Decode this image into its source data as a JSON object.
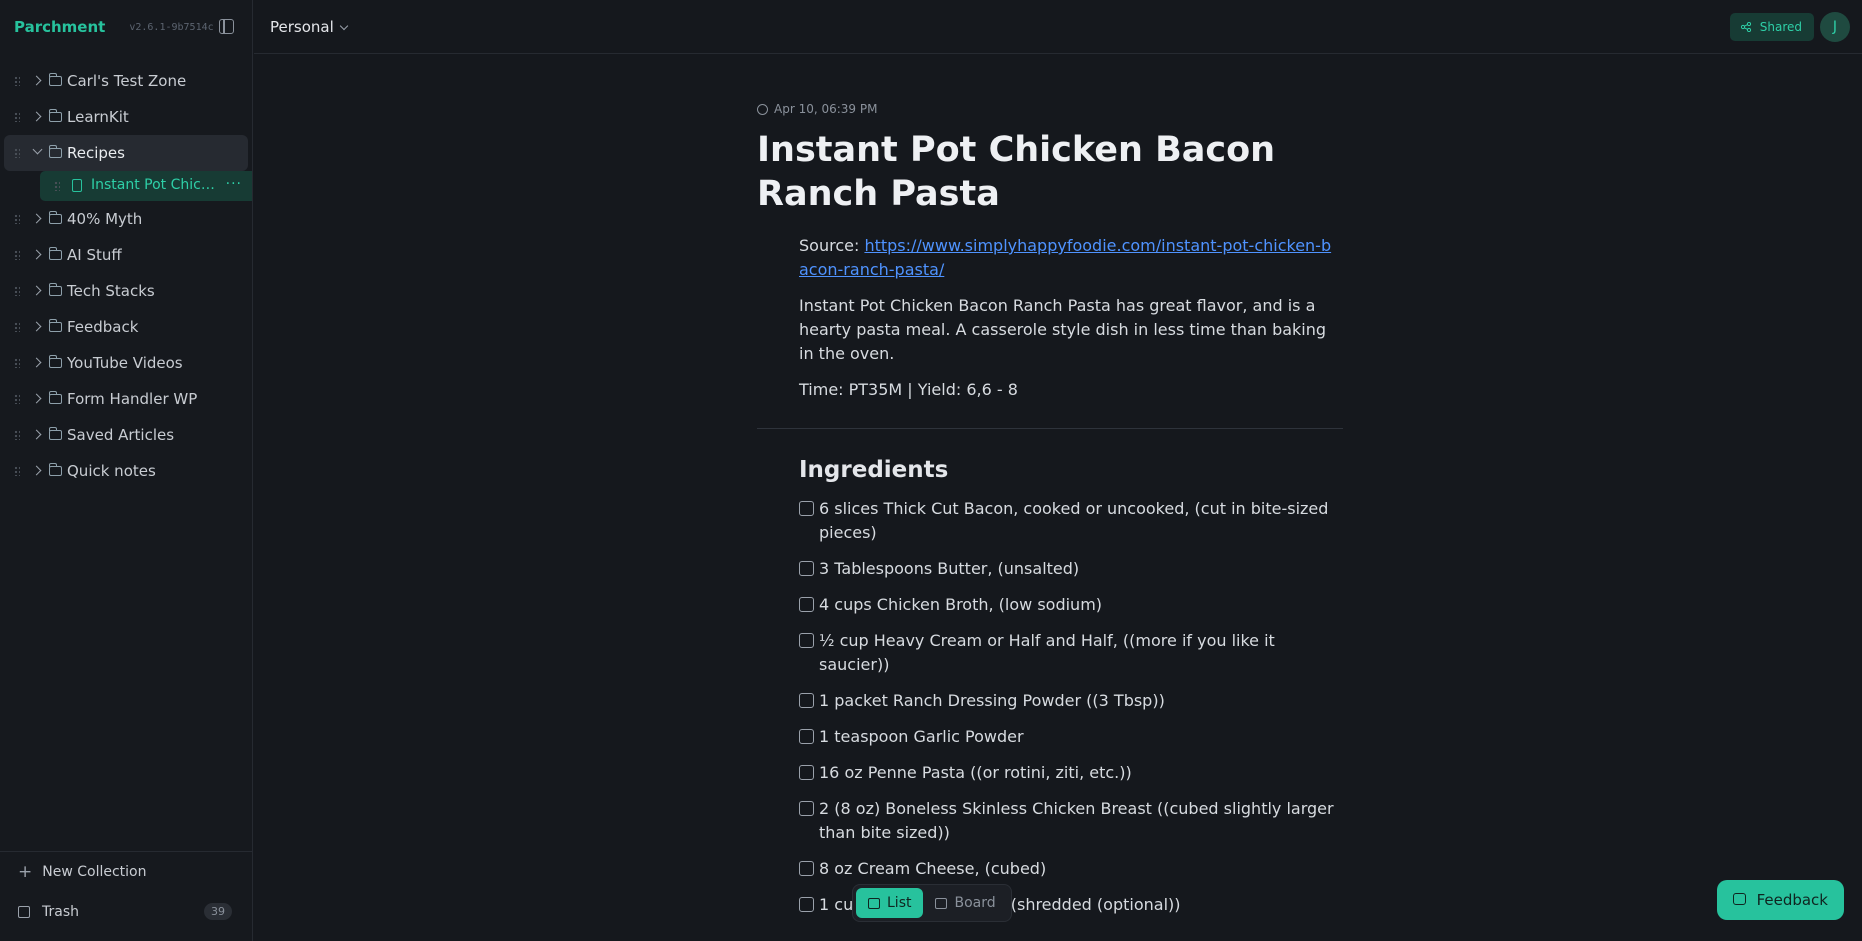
{
  "app": {
    "name": "Parchment",
    "version": "v2.6.1-9b7514c"
  },
  "header": {
    "workspace": "Personal",
    "shared_label": "Shared",
    "avatar_initial": "J"
  },
  "sidebar": {
    "items": [
      {
        "label": "Carl's Test Zone"
      },
      {
        "label": "LearnKit"
      },
      {
        "label": "Recipes"
      },
      {
        "label": "40% Myth"
      },
      {
        "label": "AI Stuff"
      },
      {
        "label": "Tech Stacks"
      },
      {
        "label": "Feedback"
      },
      {
        "label": "YouTube Videos"
      },
      {
        "label": "Form Handler WP"
      },
      {
        "label": "Saved Articles"
      },
      {
        "label": "Quick notes"
      }
    ],
    "active_child": {
      "label": "Instant Pot Chicken Bacon Ranch Pasta",
      "more": "···"
    },
    "new_collection": "New Collection",
    "trash": {
      "label": "Trash",
      "count": "39"
    }
  },
  "document": {
    "timestamp": "Apr 10, 06:39 PM",
    "title": "Instant Pot Chicken Bacon Ranch Pasta",
    "source_label": "Source: ",
    "source_url": "https://www.simplyhappyfoodie.com/instant-pot-chicken-bacon-ranch-pasta/",
    "description": "Instant Pot Chicken Bacon Ranch Pasta has great flavor, and is a hearty pasta meal. A casserole style dish in less time than baking in the oven.",
    "meta": "Time: PT35M | Yield: 6,6 - 8",
    "ingredients_heading": "Ingredients",
    "ingredients": [
      "6 slices Thick Cut Bacon, cooked or uncooked, (cut in bite-sized pieces)",
      "3 Tablespoons Butter, (unsalted)",
      "4 cups Chicken Broth, (low sodium)",
      "½ cup Heavy Cream or Half and Half, ((more if you like it saucier))",
      "1 packet Ranch Dressing Powder ((3 Tbsp))",
      "1 teaspoon Garlic Powder",
      "16 oz Penne Pasta ((or rotini, ziti, etc.))",
      "2 (8 oz) Boneless Skinless Chicken Breast ((cubed slightly larger than bite sized))",
      "8 oz Cream Cheese, (cubed)",
      "1 cup Cheddar Cheese, (shredded (optional))"
    ]
  },
  "viewbar": {
    "list": "List",
    "board": "Board"
  },
  "feedback_label": "Feedback"
}
